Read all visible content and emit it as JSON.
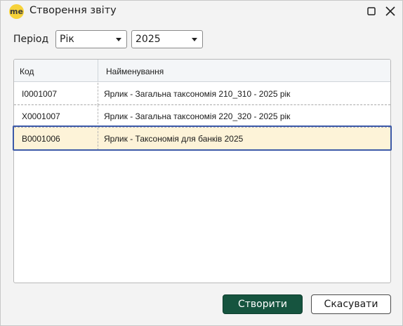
{
  "window": {
    "logo_text": "me",
    "title": "Створення звіту"
  },
  "filters": {
    "period_label": "Період",
    "period_value": "Рік",
    "year_value": "2025"
  },
  "table": {
    "columns": [
      "Код",
      "Найменування"
    ],
    "rows": [
      {
        "code": "I0001007",
        "name": "Ярлик - Загальна таксономія 210_310 - 2025 рік"
      },
      {
        "code": "X0001007",
        "name": "Ярлик - Загальна таксономія 220_320 - 2025 рік"
      },
      {
        "code": "B0001006",
        "name": "Ярлик - Таксономія для банків 2025"
      }
    ],
    "selected_index": 2
  },
  "buttons": {
    "create": "Створити",
    "cancel": "Скасувати"
  },
  "colors": {
    "primary_button": "#16543f",
    "selected_row": "#fdf3d8",
    "selection_outline": "#3d5aa8",
    "logo": "#f6d23a"
  },
  "icons": {
    "maximize": "maximize-icon",
    "close": "close-icon",
    "dropdown": "chevron-down-icon"
  }
}
